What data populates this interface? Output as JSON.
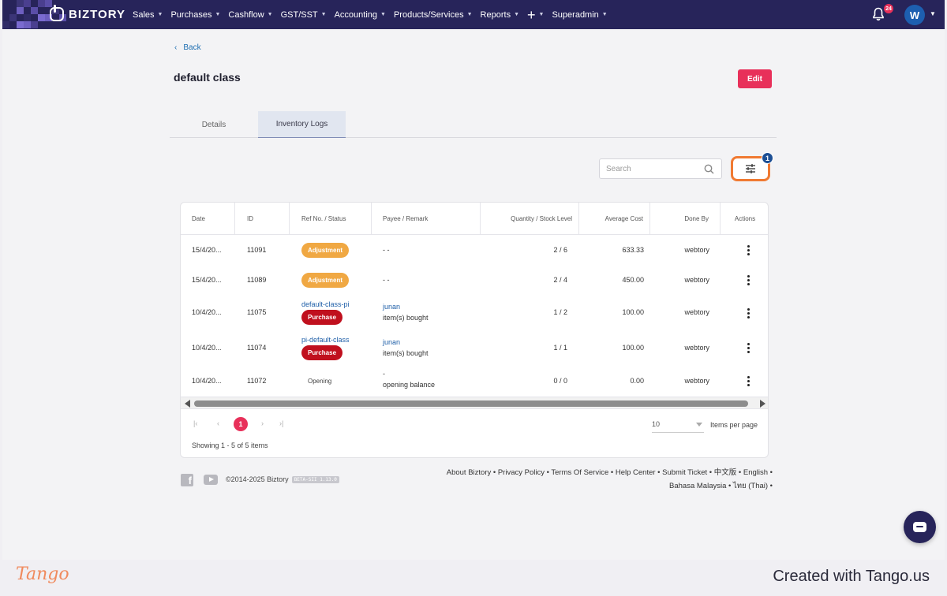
{
  "nav": {
    "brand": "BIZTORY",
    "items": [
      {
        "label": "Sales"
      },
      {
        "label": "Purchases"
      },
      {
        "label": "Cashflow"
      },
      {
        "label": "GST/SST"
      },
      {
        "label": "Accounting"
      },
      {
        "label": "Products/Services"
      },
      {
        "label": "Reports"
      },
      {
        "label": "+"
      },
      {
        "label": "Superadmin"
      }
    ],
    "notification_count": "24",
    "avatar_initial": "W",
    "accent_color": "#27245a"
  },
  "page": {
    "back_label": "Back",
    "title": "default class",
    "edit_label": "Edit"
  },
  "tabs": [
    {
      "label": "Details",
      "active": false
    },
    {
      "label": "Inventory Logs",
      "active": true
    }
  ],
  "search": {
    "placeholder": "Search"
  },
  "filter": {
    "active_count": "1"
  },
  "table": {
    "columns": [
      "Date",
      "ID",
      "Ref No. / Status",
      "Payee / Remark",
      "Quantity / Stock Level",
      "Average Cost",
      "Done By",
      "Actions"
    ],
    "rows": [
      {
        "date": "15/4/20...",
        "id": "11091",
        "ref": "",
        "status": "Adjustment",
        "status_type": "adjustment",
        "payee": "",
        "remark": "- -",
        "qty": "2 / 6",
        "cost": "633.33",
        "done_by": "webtory"
      },
      {
        "date": "15/4/20...",
        "id": "11089",
        "ref": "",
        "status": "Adjustment",
        "status_type": "adjustment",
        "payee": "",
        "remark": "- -",
        "qty": "2 / 4",
        "cost": "450.00",
        "done_by": "webtory"
      },
      {
        "date": "10/4/20...",
        "id": "11075",
        "ref": "default-class-pi",
        "status": "Purchase",
        "status_type": "purchase",
        "payee": "junan",
        "remark": "item(s) bought",
        "qty": "1 / 2",
        "cost": "100.00",
        "done_by": "webtory"
      },
      {
        "date": "10/4/20...",
        "id": "11074",
        "ref": "pi-default-class",
        "status": "Purchase",
        "status_type": "purchase",
        "payee": "junan",
        "remark": "item(s) bought",
        "qty": "1 / 1",
        "cost": "100.00",
        "done_by": "webtory"
      },
      {
        "date": "10/4/20...",
        "id": "11072",
        "ref": "",
        "status": "Opening",
        "status_type": "opening",
        "payee": "-",
        "remark": "opening balance",
        "qty": "0 / 0",
        "cost": "0.00",
        "done_by": "webtory"
      }
    ]
  },
  "pagination": {
    "current_page": "1",
    "per_page": "10",
    "per_page_label": "Items per page",
    "showing": "Showing 1 - 5 of 5 items"
  },
  "footer": {
    "copyright": "©2014-2025 Biztory",
    "version": "BETA-SII 1.13.0",
    "links_line1": "About Biztory • Privacy Policy • Terms Of Service • Help Center • Submit Ticket • 中文版 • English •",
    "links_line2": "Bahasa Malaysia • ไทย (Thai) •"
  },
  "watermark": {
    "logo": "Tango",
    "credit": "Created with Tango.us"
  }
}
